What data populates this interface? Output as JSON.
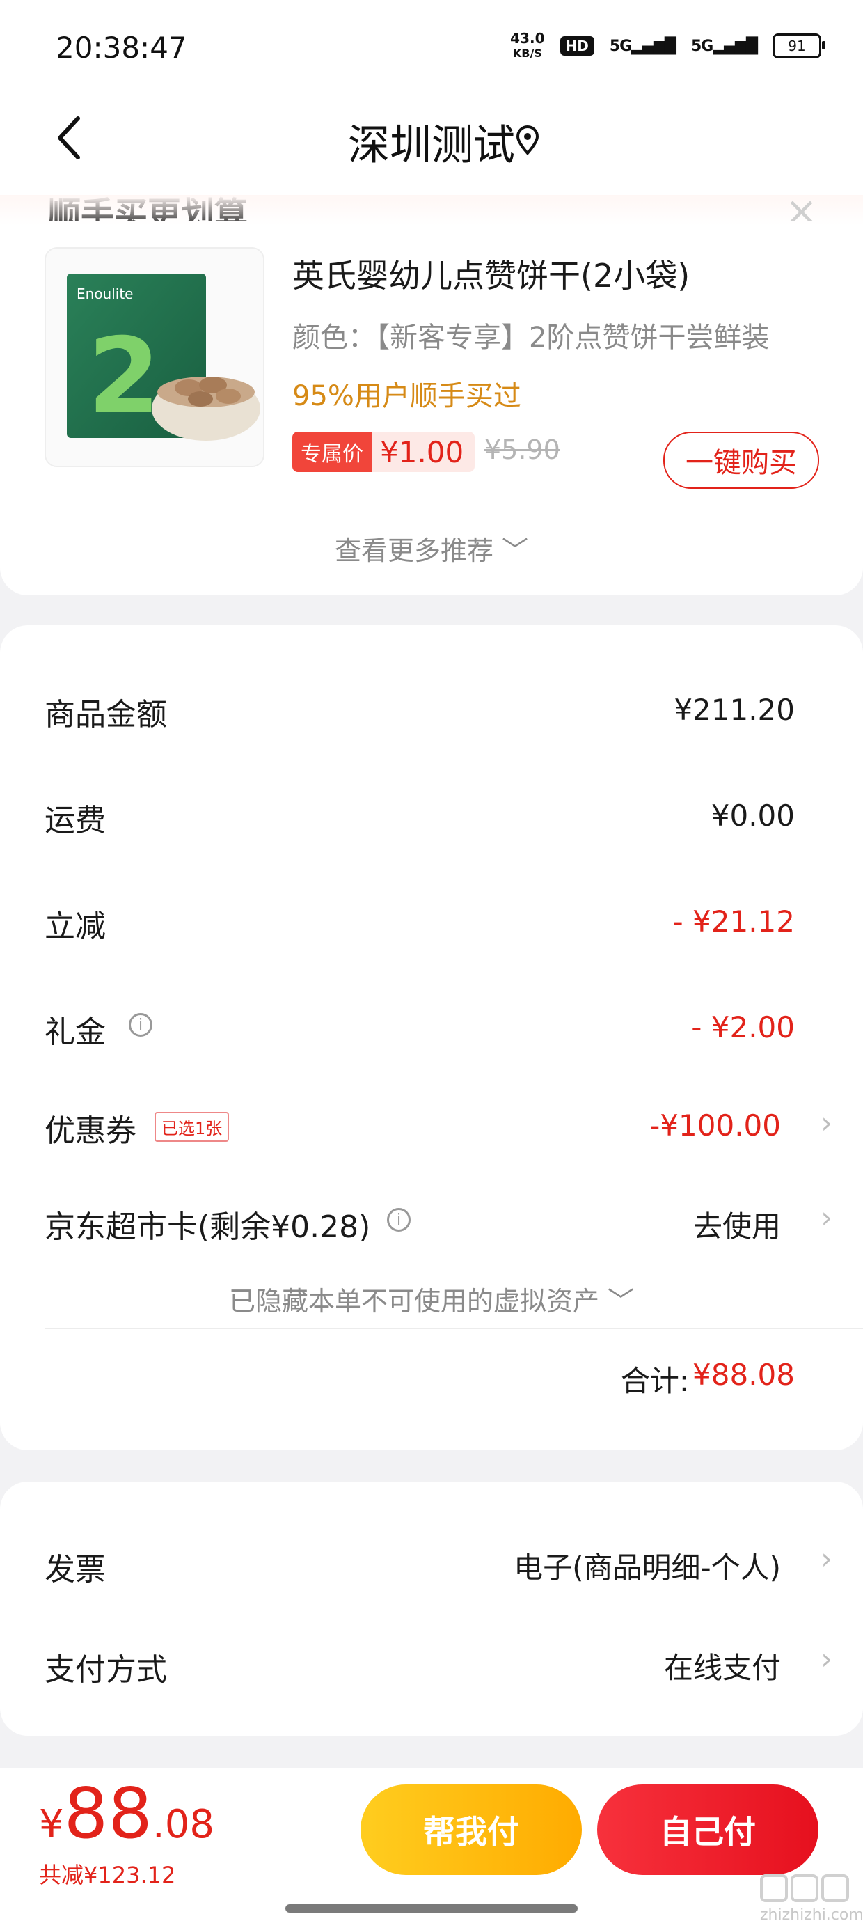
{
  "status_bar": {
    "time": "20:38:47",
    "net_speed_value": "43.0",
    "net_speed_unit": "KB/S",
    "hd_label": "HD",
    "signal1": "5G",
    "signal2": "5G",
    "battery": "91"
  },
  "header": {
    "title": "深圳测试",
    "icons": [
      "back-chevron-icon",
      "location-pin-icon"
    ]
  },
  "upsell": {
    "heading": "顺手买更划算",
    "product": {
      "name": "英氏婴幼儿点赞饼干(2小袋)",
      "spec": "颜色：【新客专享】2阶点赞饼干尝鲜装",
      "bought_note": "95%用户顺手买过",
      "price_tag_label": "专属价",
      "price": "¥1.00",
      "old_price": "¥5.90",
      "buy_button": "一键购买",
      "thumb_brand": "Enoulite",
      "thumb_stage": "2"
    },
    "more_link": "查看更多推荐"
  },
  "amounts": {
    "goods_label": "商品金额",
    "goods_value": "¥211.20",
    "shipping_label": "运费",
    "shipping_value": "¥0.00",
    "discount_label": "立减",
    "discount_value": "- ¥21.12",
    "gift_label": "礼金",
    "gift_value": "- ¥2.00",
    "coupon_label": "优惠券",
    "coupon_badge": "已选1张",
    "coupon_value": "-¥100.00",
    "card_label": "京东超市卡(剩余¥0.28)",
    "card_value": "去使用",
    "hidden_note": "已隐藏本单不可使用的虚拟资产",
    "total_label": "合计:",
    "total_value": "¥88.08"
  },
  "invoice": {
    "invoice_label": "发票",
    "invoice_value": "电子(商品明细-个人)",
    "payment_label": "支付方式",
    "payment_value": "在线支付"
  },
  "bottom_bar": {
    "currency": "¥",
    "price_int": "88",
    "price_dec": ".08",
    "savings": "共减¥123.12",
    "help_pay_button": "帮我付",
    "self_pay_button": "自己付"
  },
  "watermark": {
    "text": "zhizhizhi.com"
  },
  "colors": {
    "accent_red": "#e2231a",
    "accent_orange": "#d68a16",
    "help_button": "#ffb800"
  }
}
